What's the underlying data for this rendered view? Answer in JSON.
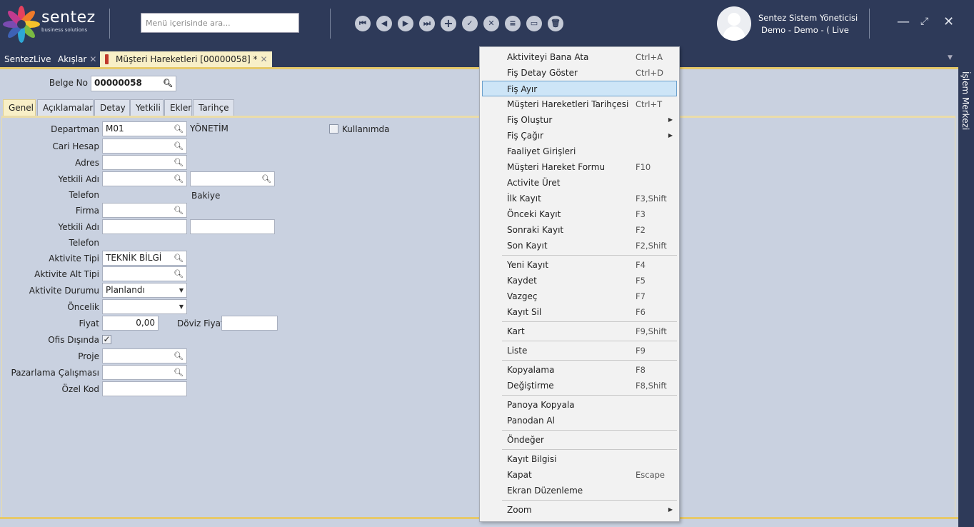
{
  "app": {
    "brand": "sentez",
    "brand_sub": "business solutions",
    "search_placeholder": "Menü içerisinde ara...",
    "user_name": "Sentez Sistem Yöneticisi",
    "user_sub": "Demo - Demo - ( Live"
  },
  "tabs": {
    "items": [
      "SentezLive",
      "Akışlar"
    ],
    "active": "Müşteri Hareketleri [00000058]  *",
    "close": "✕"
  },
  "sidebar": {
    "label": "İşlem Merkezi"
  },
  "form": {
    "belge_no_label": "Belge No",
    "belge_no_value": "00000058",
    "tabs": [
      "Genel",
      "Açıklamalar",
      "Detay",
      "Yetkili",
      "Ekler",
      "Tarihçe"
    ],
    "labels": {
      "departman": "Departman",
      "cari_hesap": "Cari Hesap",
      "adres": "Adres",
      "yetkili_adi": "Yetkili Adı",
      "telefon": "Telefon",
      "bakiye": "Bakiye",
      "firma": "Firma",
      "yetkili_adi2": "Yetkili Adı",
      "telefon2": "Telefon",
      "aktivite_tipi": "Aktivite Tipi",
      "aktivite_alt_tipi": "Aktivite Alt Tipi",
      "aktivite_durumu": "Aktivite Durumu",
      "oncelik": "Öncelik",
      "fiyat": "Fiyat",
      "doviz_fiyat": "Döviz Fiyat",
      "ofis_disinda": "Ofis Dışında",
      "proje": "Proje",
      "pazarlama": "Pazarlama Çalışması",
      "ozel_kod": "Özel Kod",
      "kullanimda": "Kullanımda"
    },
    "values": {
      "departman": "M01",
      "departman_desc": "YÖNETİM",
      "aktivite_tipi": "TEKNİK BİLGİ",
      "aktivite_durumu": "Planlandı",
      "fiyat": "0,00",
      "ofis_disinda_check": "✓"
    }
  },
  "context_menu": {
    "groups": [
      [
        {
          "label": "Aktiviteyi Bana Ata",
          "key": "Ctrl+A"
        },
        {
          "label": "Fiş Detay Göster",
          "key": "Ctrl+D"
        },
        {
          "label": "Fiş Ayır",
          "key": "",
          "highlighted": true
        },
        {
          "label": "Müşteri Hareketleri Tarihçesi",
          "key": "Ctrl+T"
        },
        {
          "label": "Fiş Oluştur",
          "key": "",
          "submenu": true
        },
        {
          "label": "Fiş Çağır",
          "key": "",
          "submenu": true
        },
        {
          "label": "Faaliyet Girişleri",
          "key": ""
        },
        {
          "label": "Müşteri Hareket Formu",
          "key": "F10"
        },
        {
          "label": "Activite Üret",
          "key": ""
        },
        {
          "label": "İlk Kayıt",
          "key": "F3,Shift"
        },
        {
          "label": "Önceki Kayıt",
          "key": "F3"
        },
        {
          "label": "Sonraki Kayıt",
          "key": "F2"
        },
        {
          "label": "Son Kayıt",
          "key": "F2,Shift"
        }
      ],
      [
        {
          "label": "Yeni Kayıt",
          "key": "F4"
        },
        {
          "label": "Kaydet",
          "key": "F5"
        },
        {
          "label": "Vazgeç",
          "key": "F7"
        },
        {
          "label": "Kayıt Sil",
          "key": "F6"
        }
      ],
      [
        {
          "label": "Kart",
          "key": "F9,Shift"
        }
      ],
      [
        {
          "label": "Liste",
          "key": "F9"
        }
      ],
      [
        {
          "label": "Kopyalama",
          "key": "F8"
        },
        {
          "label": "Değiştirme",
          "key": "F8,Shift"
        }
      ],
      [
        {
          "label": "Panoya Kopyala",
          "key": ""
        },
        {
          "label": "Panodan Al",
          "key": ""
        }
      ],
      [
        {
          "label": "Öndeğer",
          "key": ""
        }
      ],
      [
        {
          "label": "Kayıt Bilgisi",
          "key": ""
        },
        {
          "label": "Kapat",
          "key": "Escape"
        },
        {
          "label": "Ekran Düzenleme",
          "key": ""
        }
      ],
      [
        {
          "label": "Zoom",
          "key": "",
          "submenu": true
        }
      ]
    ]
  },
  "icons": {
    "first": "first-record-icon",
    "prev": "previous-record-icon",
    "next": "next-record-icon",
    "last": "last-record-icon",
    "add": "add-icon",
    "save": "check-icon",
    "cancel": "cancel-icon",
    "list": "list-icon",
    "card": "card-icon",
    "delete": "trash-icon"
  },
  "colors": {
    "header": "#2e3a59",
    "highlight": "#cde5f7",
    "active_tab": "#f8efc7"
  }
}
